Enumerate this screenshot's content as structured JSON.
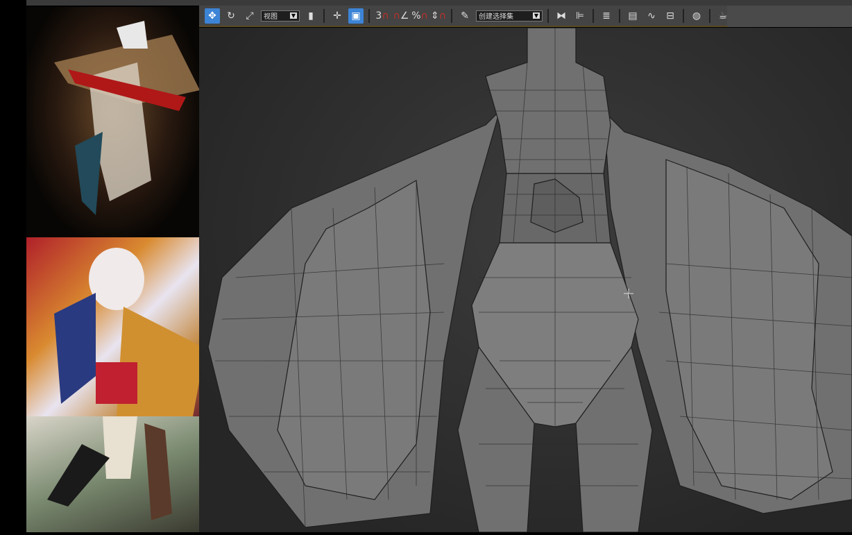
{
  "toolbar": {
    "view_dropdown": "视图",
    "selection_set_dropdown": "创建选择集",
    "icons": [
      "select-move-icon",
      "rotate-icon",
      "scale-icon",
      "view-dropdown",
      "select-region-icon",
      "pivot-icon",
      "manipulate-icon",
      "snap-3d-icon",
      "angle-snap-icon",
      "percent-snap-icon",
      "spinner-snap-icon",
      "edit-named-selection-icon",
      "mirror-icon",
      "align-icon",
      "layer-manager-icon",
      "scene-explorer-icon",
      "curve-editor-icon",
      "schematic-view-icon",
      "material-editor-icon",
      "render-setup-icon",
      "rendered-frame-icon",
      "render-icon"
    ]
  },
  "colors": {
    "active": "#3c84d6",
    "mesh": "#6c6c6c",
    "viewport": "#2e2e2e"
  }
}
